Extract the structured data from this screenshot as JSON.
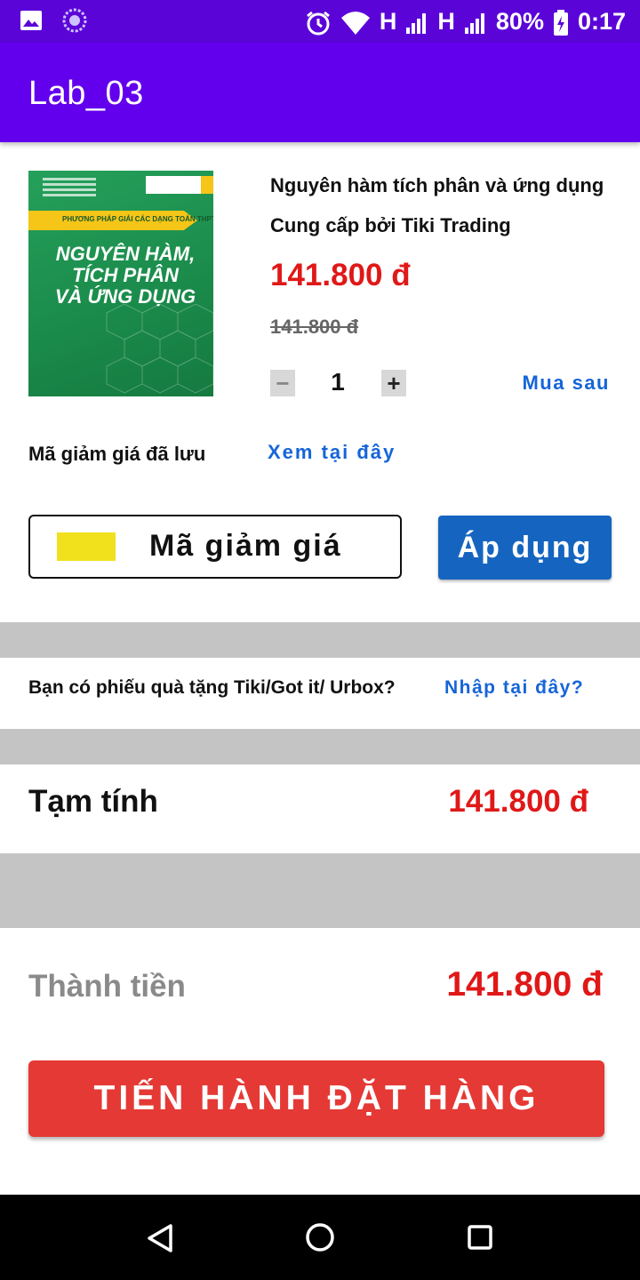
{
  "status_bar": {
    "network_h1": "H",
    "network_h2": "H",
    "battery": "80%",
    "time": "0:17",
    "icons": [
      "image-icon",
      "sync-icon",
      "alarm-icon",
      "wifi-icon",
      "signal-icon",
      "battery-charging-icon"
    ]
  },
  "app_bar": {
    "title": "Lab_03"
  },
  "product": {
    "cover": {
      "band_text": "PHƯƠNG PHÁP GIẢI CÁC DẠNG TOÁN THPT",
      "title_lines": [
        "NGUYÊN HÀM,",
        "TÍCH PHÂN",
        "VÀ ỨNG DỤNG"
      ]
    },
    "name": "Nguyên hàm tích phân và ứng dụng",
    "seller": "Cung cấp bởi Tiki Trading",
    "price": "141.800 đ",
    "old_price": "141.800 đ",
    "quantity": "1",
    "minus_label": "−",
    "plus_label": "+",
    "buy_later": "Mua sau"
  },
  "coupon": {
    "saved_label": "Mã giảm giá đã lưu",
    "see_here": "Xem tại đây",
    "input_placeholder": "Mã giảm giá",
    "apply_label": "Áp dụng"
  },
  "gift": {
    "question": "Bạn có phiếu quà tặng Tiki/Got it/ Urbox?",
    "link": "Nhập tại đây?"
  },
  "summary": {
    "subtotal_label": "Tạm tính",
    "subtotal_value": "141.800 đ",
    "total_label": "Thành tiền",
    "total_value": "141.800 đ"
  },
  "checkout": {
    "button_label": "TIẾN HÀNH ĐẶT HÀNG"
  },
  "colors": {
    "app_bar": "#6200ee",
    "status_bar": "#5b04d8",
    "price_red": "#e01818",
    "link_blue": "#1565d8",
    "apply_blue": "#1565c0",
    "checkout_red": "#e53935",
    "divider_gray": "#c4c4c4"
  }
}
